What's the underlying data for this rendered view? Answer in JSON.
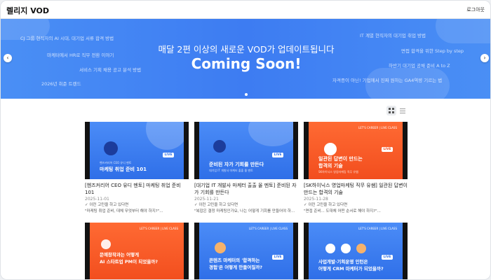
{
  "header": {
    "logo": "렐리지 VOD",
    "login_label": "로그아웃"
  },
  "banner": {
    "subtitle": "매달 2편 이상의 새로운 VOD가 업데이트됩니다",
    "title": "Coming Soon!",
    "floating_left": [
      "CJ 그룹 현직자의 AI 시대, 대기업 서류 합격 방법",
      "마케터에서 HR로 직무 전환 이야기",
      "서비스 기획 채용 공고 분석 방법",
      "2026년 취준 트렌드"
    ],
    "floating_right": [
      "IT 계열 현직자의 대기업 취업 방법",
      "면접 합격을 위한 Step by step",
      "하반기 대기업 공채 준비 A to Z",
      "자격증이 아닌! 기업에서 진짜 원하는 GA4역량 기르는 법"
    ],
    "prev_icon": "chevron-left-icon",
    "next_icon": "chevron-right-icon"
  },
  "toolbar": {
    "grid_icon": "grid-view-icon",
    "list_icon": "list-view-icon"
  },
  "cards": [
    {
      "title": "[헨즈커리어 CEO 유디 멘토] 마케팅 취업 준비 101",
      "date": "2025-11-01",
      "meta1": "✓ 이런 고민을 하고 있다면",
      "meta2": "\"마케팅 취업 준비, 대체 무엇부터 해야 하지?\"...",
      "thumb_title": "마케팅 취업 준비 101",
      "thumb_sub": "헨즈커리어 CEO 유디 멘토",
      "theme": "blue"
    },
    {
      "title": "[대기업 IT 개발사 마케터 출출 올 멘토] 준비된 자가 기회를 만든다",
      "date": "2025-11-21",
      "meta1": "✓ 이런 고민을 하고 있다면",
      "meta2": "\"복잡은 결정 마케팅인가요, 나는 어떻게 기회를 만들어야 하...",
      "thumb_title": "준비된 자가 기회를 만든다",
      "thumb_sub": "대기업 IT 개발사 마케터 출출 올 멘토",
      "theme": "blue"
    },
    {
      "title": "[SK하이닉스 영업마케팅 직무 유쌤] 일관된 답변이 만드는 합격의 기술",
      "date": "2025-11-28",
      "meta1": "✓ 이런 고민을 하고 있다면",
      "meta2": "\"면접 준비... 도대체 어떤 순서로 해야 하지?\"...",
      "thumb_title": "일관된 답변이 만드는",
      "thumb_title2": "합격의 기술",
      "thumb_sub": "SK하이닉스 영업마케팅 직무 유쌤",
      "theme": "orange"
    },
    {
      "thumb_title": "문예창작과는 어떻게",
      "thumb_title2": "AI 스타트업 PM이 되었을까?",
      "theme": "orange"
    },
    {
      "thumb_title": "콘텐츠 마케터의 '합격하는",
      "thumb_title2": "경험'은 어떻게 만들어질까?",
      "theme": "blue"
    },
    {
      "thumb_title": "사업개발·기획운영 인턴은",
      "thumb_title2": "어떻게 CRM 마케터가 되었을까?",
      "theme": "blue"
    }
  ],
  "labels": {
    "live": "LIVE",
    "brand": "LET'S CAREER | LIVE CLASS"
  }
}
